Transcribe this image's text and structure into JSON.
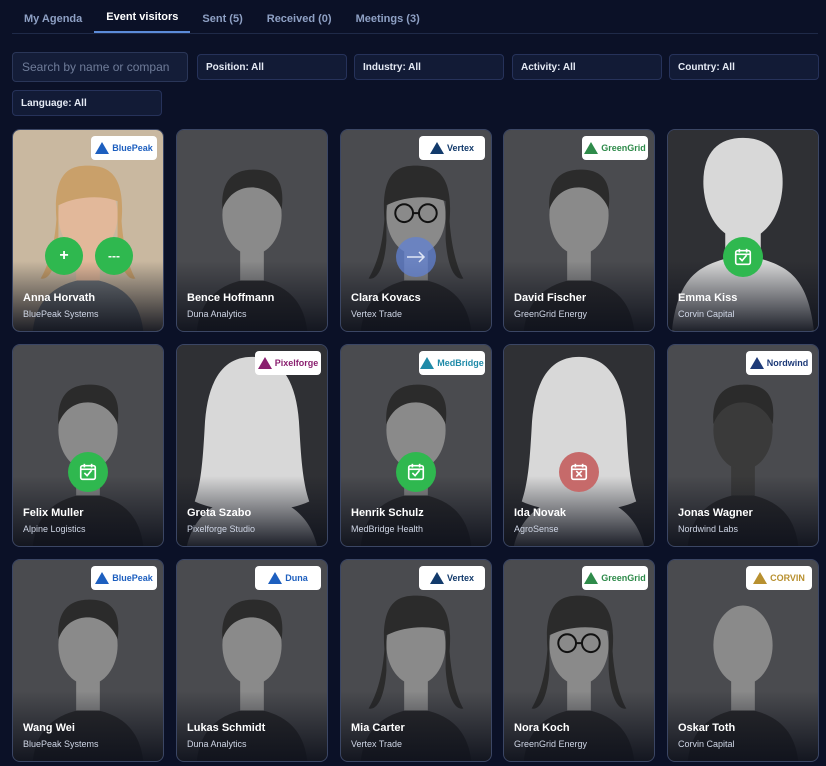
{
  "tabs": [
    {
      "label": "My Agenda"
    },
    {
      "label": "Event visitors"
    },
    {
      "label": "Sent (5)"
    },
    {
      "label": "Received (0)"
    },
    {
      "label": "Meetings (3)"
    }
  ],
  "search": {
    "placeholder": "Search by name or compan"
  },
  "filters": {
    "position": "Position: All",
    "industry": "Industry: All",
    "activity": "Activity: All",
    "country": "Country: All",
    "language": "Language: All"
  },
  "actions": {
    "add": "+",
    "more": "---"
  },
  "colors": {
    "background": "#0b1127",
    "accent_green": "#2fb84f",
    "accent_red": "#c66a6a",
    "tab_underline": "#5b8bd9"
  },
  "cards": [
    {
      "name": "Anna Horvath",
      "company": "BluePeak Systems",
      "logo": "BluePeak",
      "status": "actions",
      "photo": "color-female"
    },
    {
      "name": "Bence Hoffmann",
      "company": "Duna Analytics",
      "logo": "",
      "status": "",
      "photo": "male"
    },
    {
      "name": "Clara Kovacs",
      "company": "Vertex Trade",
      "logo": "Vertex",
      "status": "arrow",
      "photo": "female-glasses"
    },
    {
      "name": "David Fischer",
      "company": "GreenGrid Energy",
      "logo": "GreenGrid",
      "status": "",
      "photo": "male"
    },
    {
      "name": "Emma Kiss",
      "company": "Corvin Capital",
      "logo": "",
      "status": "calendar-check",
      "photo": "silhouette-male"
    },
    {
      "name": "Felix Muller",
      "company": "Alpine Logistics",
      "logo": "",
      "status": "calendar-check",
      "photo": "male"
    },
    {
      "name": "Greta Szabo",
      "company": "Pixelforge Studio",
      "logo": "Pixelforge",
      "status": "",
      "photo": "silhouette-female"
    },
    {
      "name": "Henrik Schulz",
      "company": "MedBridge Health",
      "logo": "MedBridge",
      "status": "calendar-check",
      "photo": "male"
    },
    {
      "name": "Ida Novak",
      "company": "AgroSense",
      "logo": "",
      "status": "calendar-x",
      "photo": "silhouette-female"
    },
    {
      "name": "Jonas Wagner",
      "company": "Nordwind Labs",
      "logo": "Nordwind",
      "status": "",
      "photo": "male-dark"
    },
    {
      "name": "Wang Wei",
      "company": "BluePeak Systems",
      "logo": "BluePeak",
      "status": "",
      "photo": "male"
    },
    {
      "name": "Lukas Schmidt",
      "company": "Duna Analytics",
      "logo": "Duna",
      "status": "",
      "photo": "male"
    },
    {
      "name": "Mia Carter",
      "company": "Vertex Trade",
      "logo": "Vertex",
      "status": "",
      "photo": "female"
    },
    {
      "name": "Nora Koch",
      "company": "GreenGrid Energy",
      "logo": "GreenGrid",
      "status": "",
      "photo": "female-glasses"
    },
    {
      "name": "Oskar Toth",
      "company": "Corvin Capital",
      "logo": "CORVIN",
      "status": "",
      "photo": "male-bald"
    }
  ]
}
